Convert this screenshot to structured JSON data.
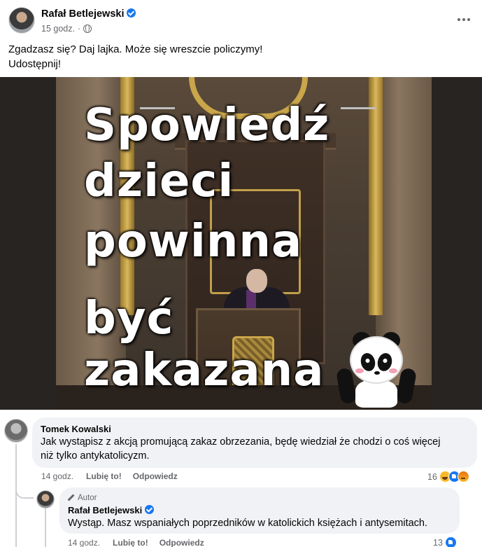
{
  "post": {
    "author": "Rafał Betlejewski",
    "time": "15 godz.",
    "separator": "·",
    "text_line1": "Zgadzasz się? Daj lajka. Może się wreszcie policzymy!",
    "text_line2": "Udostępnij!",
    "more_icon": "more-horizontal-icon",
    "privacy_icon": "globe-icon"
  },
  "meme": {
    "line1": "Spowiedź",
    "line2": "dzieci",
    "line3": "powinna",
    "line4": "być",
    "line5": "zakazana"
  },
  "comments": [
    {
      "author": "Tomek Kowalski",
      "text_line1": "Jak wystąpisz z akcją promującą zakaz obrzezania, będę wiedział że chodzi o coś więcej",
      "text_line2": "niż tylko antykatolicyzm.",
      "time": "14 godz.",
      "like_label": "Lubię to!",
      "reply_label": "Odpowiedz",
      "reaction_count": "16",
      "reactions": [
        "haha-icon",
        "like-icon",
        "angry-icon"
      ]
    },
    {
      "author_tag": "Autor",
      "author": "Rafał Betlejewski",
      "text": "Wystąp. Masz wspaniałych poprzedników w katolickich księżach i antysemitach.",
      "time": "14 godz.",
      "like_label": "Lubię to!",
      "reply_label": "Odpowiedz",
      "reaction_count": "13",
      "reactions": [
        "like-icon"
      ]
    }
  ],
  "colors": {
    "link_blue": "#1877f2",
    "secondary_text": "#65676b",
    "bubble_bg": "#f0f2f5"
  }
}
